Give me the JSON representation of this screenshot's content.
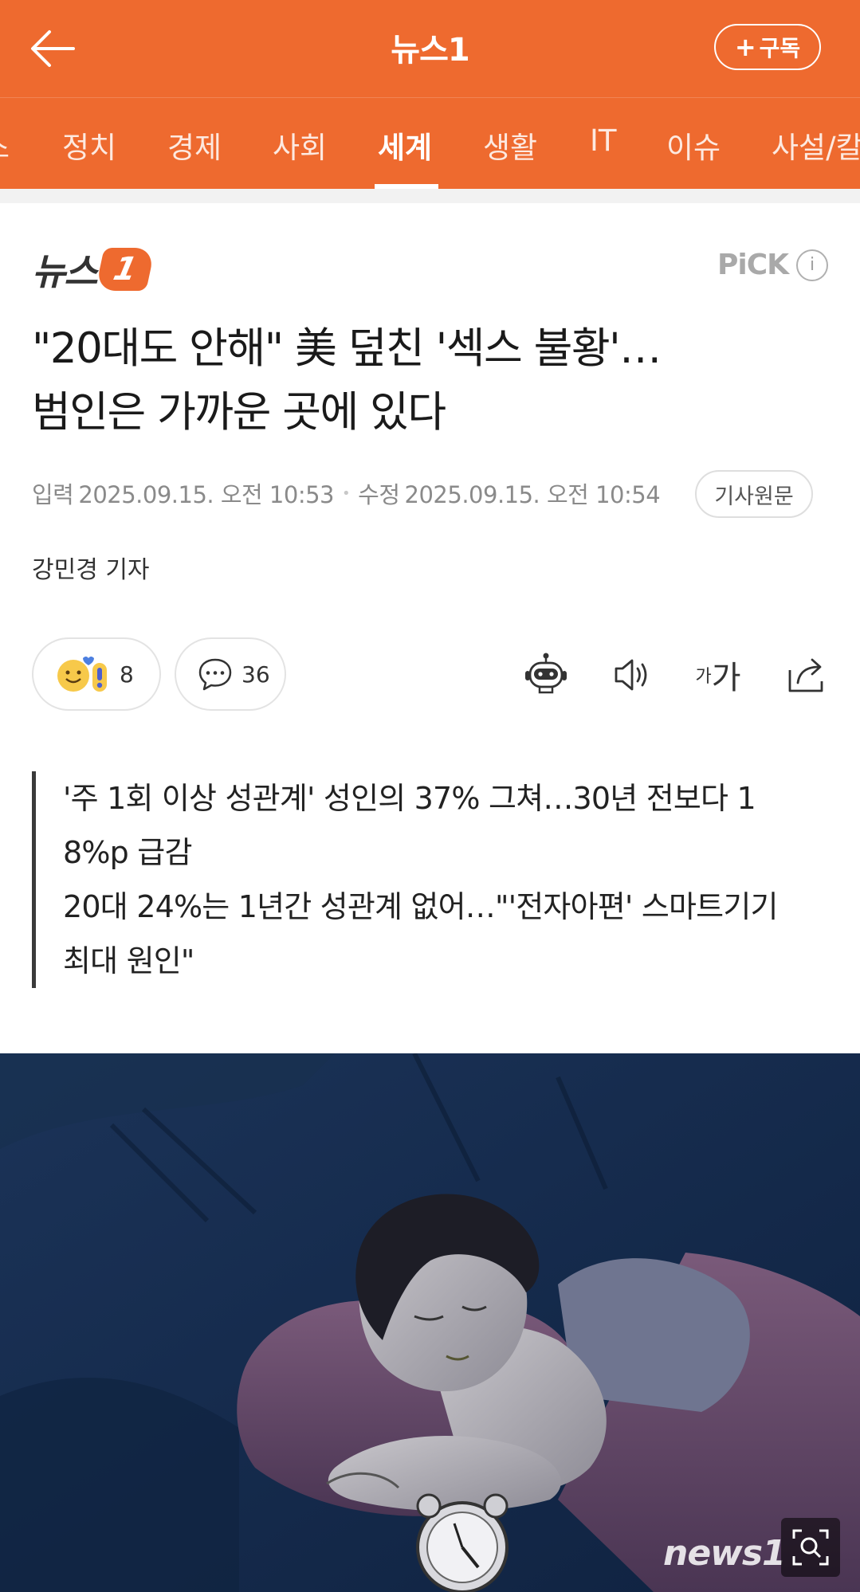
{
  "header": {
    "title": "뉴스1",
    "subscribe_label": "구독"
  },
  "tabs": [
    {
      "label": "스"
    },
    {
      "label": "정치"
    },
    {
      "label": "경제"
    },
    {
      "label": "사회"
    },
    {
      "label": "세계",
      "active": true
    },
    {
      "label": "생활"
    },
    {
      "label": "IT"
    },
    {
      "label": "이슈"
    },
    {
      "label": "사설/칼"
    }
  ],
  "article": {
    "source_logo_text": "뉴스",
    "source_logo_mark": "1",
    "pick_label": "PiCK",
    "pick_info": "i",
    "headline_line1": "\"20대도 안해\" 美 덮친 '섹스 불황'…",
    "headline_line2": "범인은 가까운 곳에 있다",
    "input_label": "입력",
    "input_date": "2025.09.15. 오전 10:53",
    "modified_label": "수정",
    "modified_date": "2025.09.15. 오전 10:54",
    "original_button": "기사원문",
    "reporter": "강민경 기자"
  },
  "actions": {
    "reaction_count": "8",
    "comment_count": "36",
    "font_size_small": "가",
    "font_size_large": "가"
  },
  "summary": {
    "line1": "'주 1회 이상 성관계' 성인의 37% 그쳐…30년 전보다 1",
    "line2": "8%p 급감",
    "line3": "20대 24%는 1년간 성관계 없어…\"'전자아편' 스마트기기",
    "line4": "최대 원인\""
  },
  "photo": {
    "watermark": "news1"
  },
  "colors": {
    "brand": "#ee6a2f",
    "photo_bg": "#13294a"
  }
}
